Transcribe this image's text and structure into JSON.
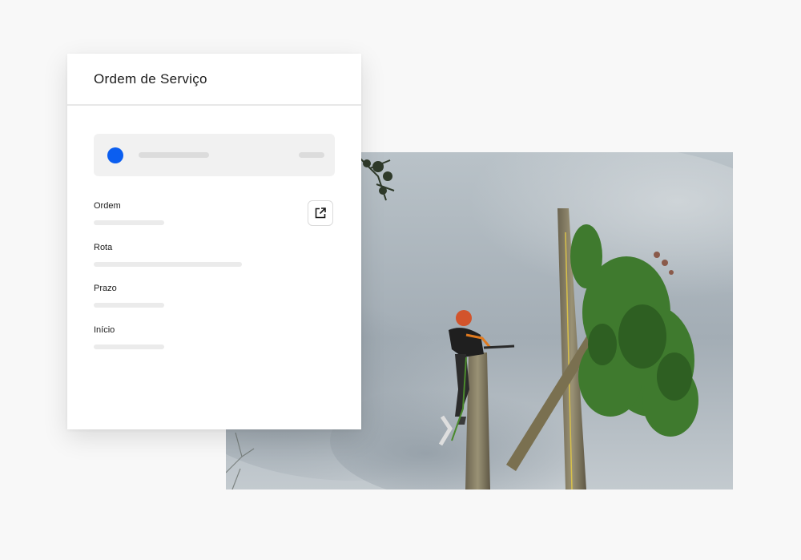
{
  "card": {
    "title": "Ordem de Serviço",
    "selector": {
      "status_color": "#0b5ef0"
    },
    "fields": [
      {
        "label": "Ordem"
      },
      {
        "label": "Rota"
      },
      {
        "label": "Prazo"
      },
      {
        "label": "Início"
      }
    ],
    "open_button_icon": "external-link-icon"
  },
  "colors": {
    "accent": "#0b5ef0",
    "background": "#f8f8f8",
    "card": "#ffffff"
  }
}
